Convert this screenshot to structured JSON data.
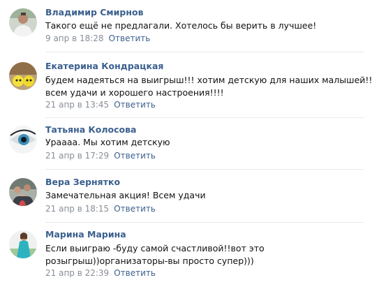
{
  "comments": [
    {
      "author": "Владимир Смирнов",
      "lines": [
        "Такого ещё не предлагали. Хотелось бы верить в лучшее!"
      ],
      "date": "9 апр в 18:28",
      "reply": "Ответить",
      "avatar_icon": "person-photo-avatar"
    },
    {
      "author": "Екатерина Кондрацкая",
      "lines": [
        "будем надеяться на выигрыш!!! хотим детскую для наших малышей!!",
        "всем удачи и хорошего настроения!!!!"
      ],
      "date": "21 апр в 13:45",
      "reply": "Ответить",
      "avatar_icon": "yellow-balls-avatar"
    },
    {
      "author": "Татьяна Колосова",
      "lines": [
        "Ураааа. Мы хотим детскую"
      ],
      "date": "21 апр в 17:29",
      "reply": "Ответить",
      "avatar_icon": "eye-avatar"
    },
    {
      "author": "Вера Зернятко",
      "lines": [
        "Замечательная акция! Всем удачи"
      ],
      "date": "21 апр в 18:15",
      "reply": "Ответить",
      "avatar_icon": "family-photo-avatar"
    },
    {
      "author": "Марина Марина",
      "lines": [
        "Если выиграю -буду самой счастливой!!вот это",
        "розыгрыш))организаторы-вы просто супер)))"
      ],
      "date": "21 апр в 22:39",
      "reply": "Ответить",
      "avatar_icon": "woman-blue-dress-avatar"
    }
  ],
  "colors": {
    "author": "#3a5f8e",
    "text": "#111111",
    "meta": "#888e97",
    "divider": "#e6e9ed"
  }
}
